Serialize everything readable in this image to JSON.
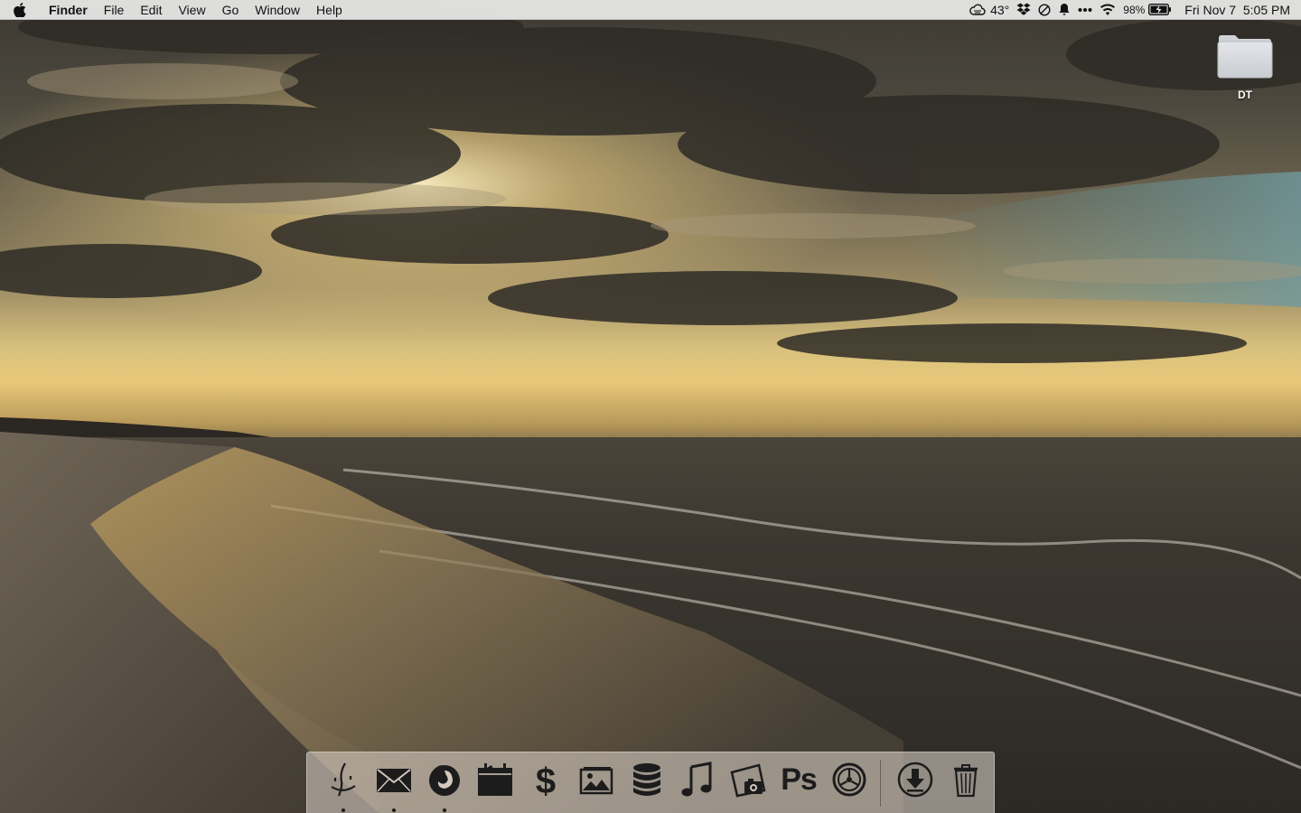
{
  "menubar": {
    "apple_icon": "apple-icon",
    "app_name": "Finder",
    "menus": [
      "File",
      "Edit",
      "View",
      "Go",
      "Window",
      "Help"
    ],
    "status": {
      "weather_icon": "cloud-icon",
      "temperature": "43°",
      "dropbox_icon": "dropbox-icon",
      "dnd_icon": "do-not-disturb-icon",
      "notification_icon": "bell-icon",
      "more_icon": "ellipsis-icon",
      "wifi_icon": "wifi-icon",
      "battery_percent": "98%",
      "battery_icon": "battery-charging-icon",
      "clock": "Fri Nov 7  5:05 PM"
    }
  },
  "desktop": {
    "items": [
      {
        "label": "DT",
        "icon": "folder-icon"
      }
    ]
  },
  "dock": {
    "apps": [
      {
        "name": "Finder",
        "icon": "finder-icon",
        "running": true
      },
      {
        "name": "Mail",
        "icon": "mail-icon",
        "running": true
      },
      {
        "name": "Firefox",
        "icon": "firefox-icon",
        "running": true
      },
      {
        "name": "Calendar",
        "icon": "calendar-icon",
        "running": false
      },
      {
        "name": "Money",
        "icon": "dollar-icon",
        "running": false
      },
      {
        "name": "Photos",
        "icon": "photos-icon",
        "running": false
      },
      {
        "name": "Database",
        "icon": "database-icon",
        "running": false
      },
      {
        "name": "Music",
        "icon": "music-icon",
        "running": false
      },
      {
        "name": "Image Capture",
        "icon": "camera-photo-icon",
        "running": false
      },
      {
        "name": "Photoshop",
        "icon": "photoshop-icon",
        "label": "Ps",
        "running": false
      },
      {
        "name": "System Preferences",
        "icon": "gear-icon",
        "running": false
      }
    ],
    "stacks": [
      {
        "name": "Downloads",
        "icon": "download-icon"
      },
      {
        "name": "Trash",
        "icon": "trash-icon"
      }
    ]
  },
  "colors": {
    "menubar_bg": "#ebebeb",
    "dock_bg": "#d2c8be",
    "icon_fill": "#1c1c1c",
    "label_text": "#ffffff"
  }
}
